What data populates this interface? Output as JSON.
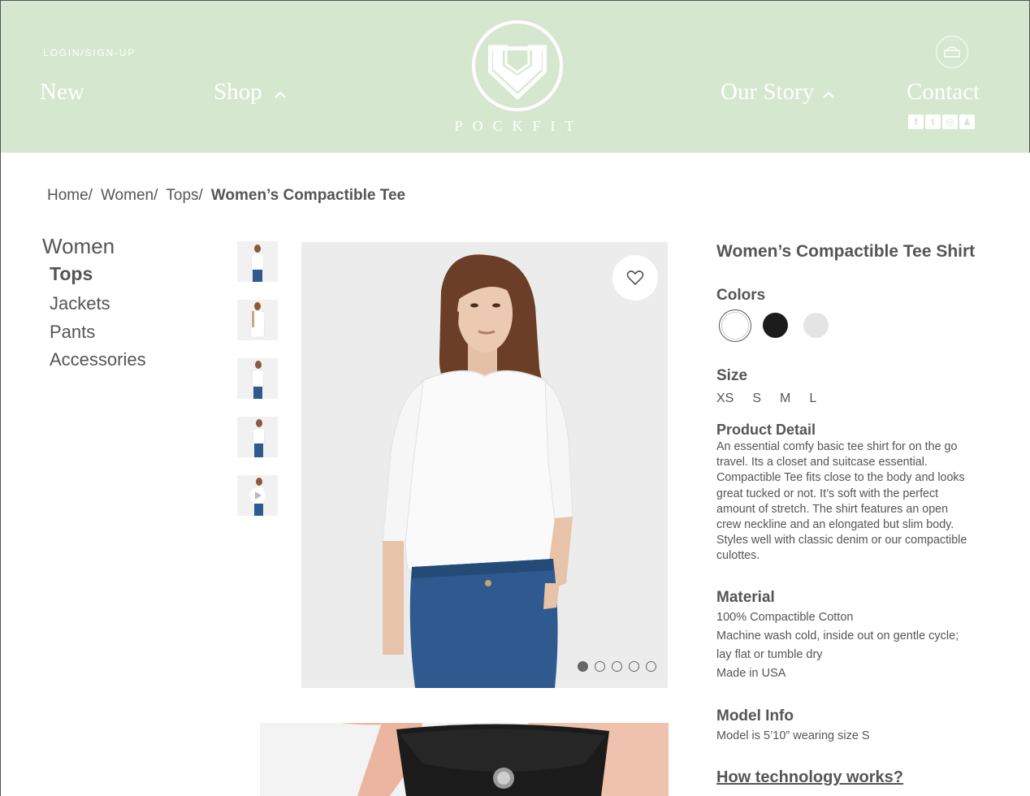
{
  "header": {
    "login_label": "LOGIN/SIGN-UP",
    "nav": {
      "new": "New",
      "shop": "Shop",
      "our_story": "Our Story",
      "contact": "Contact"
    },
    "brand": "POCKFIT",
    "socials": [
      "facebook-icon",
      "twitter-icon",
      "instagram-icon",
      "snapchat-icon"
    ],
    "bg_color": "#d5e8cf"
  },
  "breadcrumb": {
    "items": [
      "Home/",
      "Women/",
      "Tops/"
    ],
    "current": "Women’s Compactible Tee"
  },
  "sidebar": {
    "title": "Women",
    "items": [
      {
        "label": "Tops",
        "active": true
      },
      {
        "label": "Jackets",
        "active": false
      },
      {
        "label": "Pants",
        "active": false
      },
      {
        "label": "Accessories",
        "active": false
      }
    ]
  },
  "gallery": {
    "thumbnail_count": 5,
    "active_slide": 1,
    "slide_count": 5,
    "last_thumbnail_is_video": true
  },
  "product": {
    "title": "Women’s Compactible Tee Shirt",
    "colors_label": "Colors",
    "colors": [
      {
        "name": "white",
        "hex": "#ffffff",
        "selected": true
      },
      {
        "name": "black",
        "hex": "#1c1c1c",
        "selected": false
      },
      {
        "name": "grey",
        "hex": "#e4e4e4",
        "selected": false
      }
    ],
    "size_label": "Size",
    "sizes": [
      "XS",
      "S",
      "M",
      "L"
    ],
    "detail_label": "Product Detail",
    "detail_text": "An essential comfy basic tee shirt for on the go travel. Its a closet and suitcase essential. Compactible Tee fits close to the body and looks great tucked or not. It’s soft with the perfect amount of stretch. The shirt features an open crew neckline and an elongated but slim body. Styles well with classic denim or our compactible culottes.",
    "material_label": "Material",
    "material_lines": [
      "100% Compactible Cotton",
      "Machine wash cold, inside out on gentle cycle;",
      "lay flat or tumble dry",
      "Made in USA"
    ],
    "model_label": "Model Info",
    "model_text": "Model is 5’10” wearing size S",
    "tech_link": "How technology works?"
  }
}
